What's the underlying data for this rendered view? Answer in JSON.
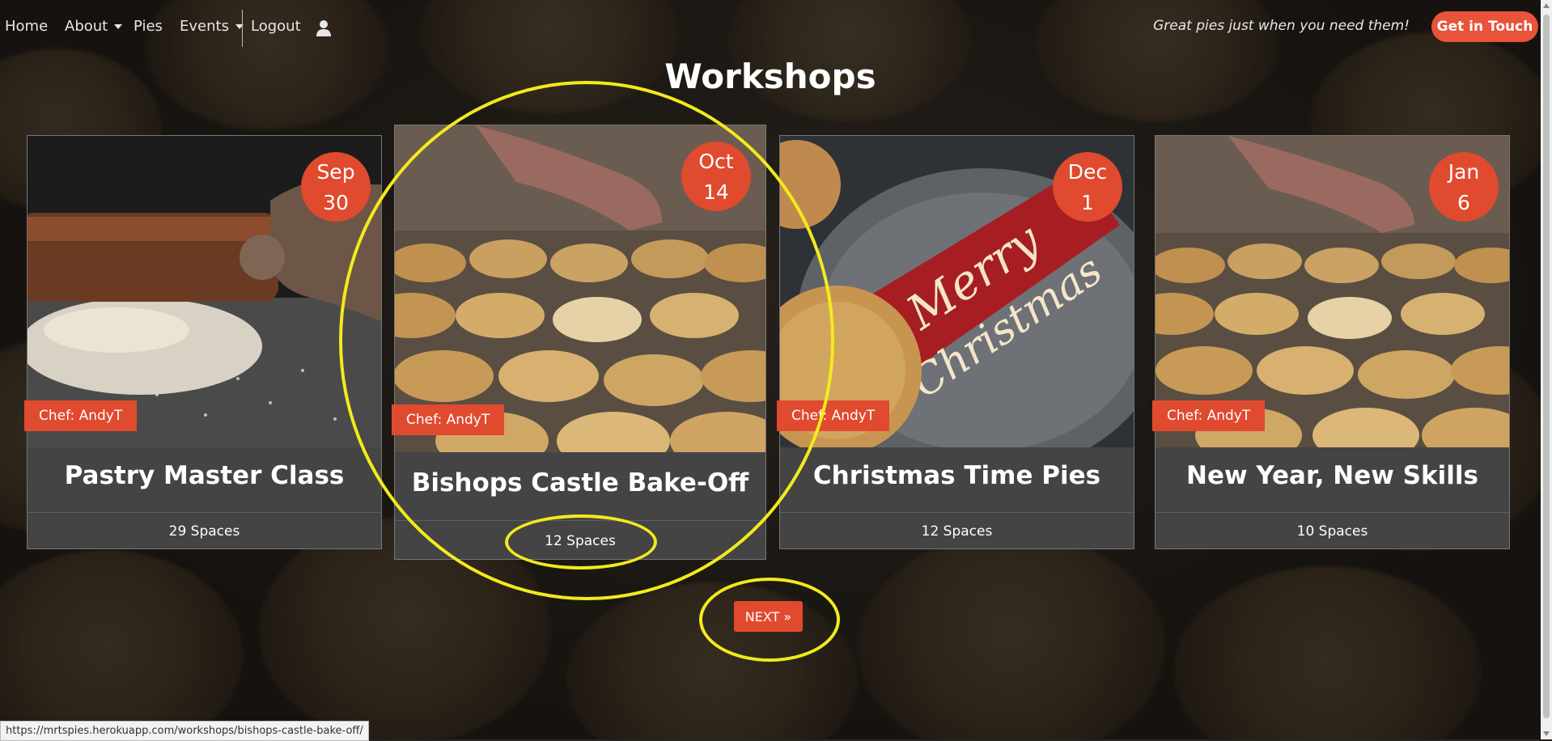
{
  "nav": {
    "home": "Home",
    "about": "About",
    "pies": "Pies",
    "events": "Events",
    "logout": "Logout",
    "user_icon": "user-icon"
  },
  "header": {
    "tagline": "Great pies just when you need them!",
    "contact_label": "Get in Touch"
  },
  "page": {
    "title": "Workshops"
  },
  "cards": [
    {
      "month": "Sep",
      "day": "30",
      "chef": "Chef: AndyT",
      "title": "Pastry Master Class",
      "spaces": "29 Spaces",
      "image": "rolling-pin-dough"
    },
    {
      "month": "Oct",
      "day": "14",
      "chef": "Chef: AndyT",
      "title": "Bishops Castle Bake-Off",
      "spaces": "12 Spaces",
      "image": "tray-of-pies"
    },
    {
      "month": "Dec",
      "day": "1",
      "chef": "Chef: AndyT",
      "title": "Christmas Time Pies",
      "spaces": "12 Spaces",
      "image": "merry-christmas-tag"
    },
    {
      "month": "Jan",
      "day": "6",
      "chef": "Chef: AndyT",
      "title": "New Year, New Skills",
      "spaces": "10 Spaces",
      "image": "tray-of-pies"
    }
  ],
  "pagination": {
    "next_label": "NEXT »"
  },
  "status_bar": {
    "url": "https://mrtspies.herokuapp.com/workshops/bishops-castle-bake-off/"
  },
  "colors": {
    "accent": "#e04a2f",
    "annotation": "#f2ea1c",
    "card_bg": "#444444"
  }
}
